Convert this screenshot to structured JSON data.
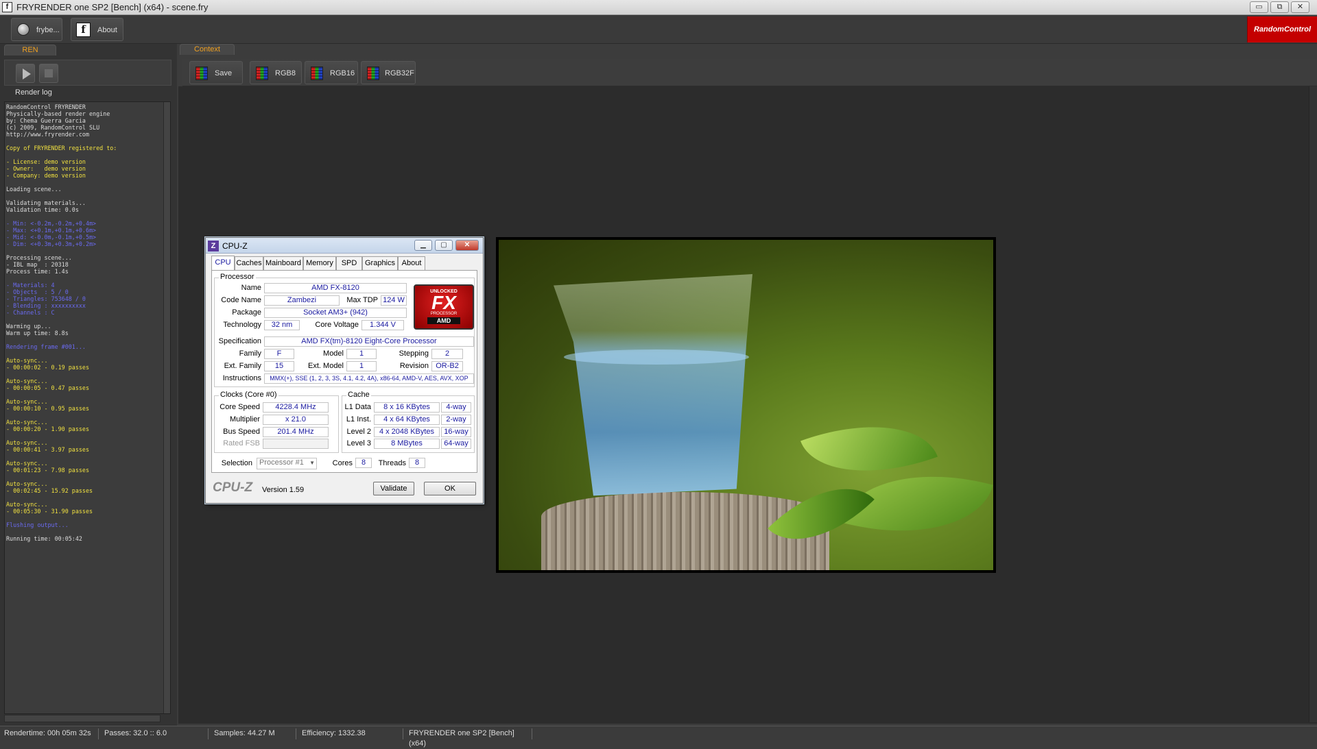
{
  "window": {
    "title": "FRYRENDER one SP2 [Bench] (x64) - scene.fry",
    "app_icon": "f",
    "controls": [
      "▭",
      "⧉",
      "✕"
    ]
  },
  "toolbar": {
    "user_label": "frybe...",
    "about_label": "About",
    "brand": "RandomControl"
  },
  "left": {
    "tab": "REN",
    "log_label": "Render log",
    "log_lines": [
      {
        "t": "RandomControl FRYRENDER",
        "c": "#dddddd"
      },
      {
        "t": "Physically-based render engine",
        "c": "#dddddd"
      },
      {
        "t": "by: Chema Guerra Garcia",
        "c": "#dddddd"
      },
      {
        "t": "(c) 2009, RandomControl SLU",
        "c": "#dddddd"
      },
      {
        "t": "http://www.fryrender.com",
        "c": "#dddddd"
      },
      {
        "t": "",
        "c": "#dddddd"
      },
      {
        "t": "Copy of FRYRENDER registered to:",
        "c": "#f0e040"
      },
      {
        "t": "",
        "c": "#dddddd"
      },
      {
        "t": "- License: demo version",
        "c": "#f0e040"
      },
      {
        "t": "- Owner:   demo version",
        "c": "#f0e040"
      },
      {
        "t": "- Company: demo version",
        "c": "#f0e040"
      },
      {
        "t": "",
        "c": "#dddddd"
      },
      {
        "t": "Loading scene...",
        "c": "#dddddd"
      },
      {
        "t": "",
        "c": "#dddddd"
      },
      {
        "t": "Validating materials...",
        "c": "#dddddd"
      },
      {
        "t": "Validation time: 0.0s",
        "c": "#dddddd"
      },
      {
        "t": "",
        "c": "#dddddd"
      },
      {
        "t": "- Min: <-0.2m,-0.2m,+0.4m>",
        "c": "#6a6af0"
      },
      {
        "t": "- Max: <+0.1m,+0.1m,+0.6m>",
        "c": "#6a6af0"
      },
      {
        "t": "- Mid: <-0.0m,-0.1m,+0.5m>",
        "c": "#6a6af0"
      },
      {
        "t": "- Dim: <+0.3m,+0.3m,+0.2m>",
        "c": "#6a6af0"
      },
      {
        "t": "",
        "c": "#dddddd"
      },
      {
        "t": "Processing scene...",
        "c": "#dddddd"
      },
      {
        "t": "- IBL map  : 20318",
        "c": "#dddddd"
      },
      {
        "t": "Process time: 1.4s",
        "c": "#dddddd"
      },
      {
        "t": "",
        "c": "#dddddd"
      },
      {
        "t": "- Materials: 4",
        "c": "#6a6af0"
      },
      {
        "t": "- Objects  : 5 / 0",
        "c": "#6a6af0"
      },
      {
        "t": "- Triangles: 753648 / 0",
        "c": "#6a6af0"
      },
      {
        "t": "- Blending : xxxxxxxxxx",
        "c": "#6a6af0"
      },
      {
        "t": "- Channels : C",
        "c": "#6a6af0"
      },
      {
        "t": "",
        "c": "#dddddd"
      },
      {
        "t": "Warming up...",
        "c": "#dddddd"
      },
      {
        "t": "Warm up time: 8.8s",
        "c": "#dddddd"
      },
      {
        "t": "",
        "c": "#dddddd"
      },
      {
        "t": "Rendering frame #001...",
        "c": "#6a6af0"
      },
      {
        "t": "",
        "c": "#dddddd"
      },
      {
        "t": "Auto-sync...",
        "c": "#f0e040"
      },
      {
        "t": "- 00:00:02 - 0.19 passes",
        "c": "#f0e040"
      },
      {
        "t": "",
        "c": "#dddddd"
      },
      {
        "t": "Auto-sync...",
        "c": "#f0e040"
      },
      {
        "t": "- 00:00:05 - 0.47 passes",
        "c": "#f0e040"
      },
      {
        "t": "",
        "c": "#dddddd"
      },
      {
        "t": "Auto-sync...",
        "c": "#f0e040"
      },
      {
        "t": "- 00:00:10 - 0.95 passes",
        "c": "#f0e040"
      },
      {
        "t": "",
        "c": "#dddddd"
      },
      {
        "t": "Auto-sync...",
        "c": "#f0e040"
      },
      {
        "t": "- 00:00:20 - 1.90 passes",
        "c": "#f0e040"
      },
      {
        "t": "",
        "c": "#dddddd"
      },
      {
        "t": "Auto-sync...",
        "c": "#f0e040"
      },
      {
        "t": "- 00:00:41 - 3.97 passes",
        "c": "#f0e040"
      },
      {
        "t": "",
        "c": "#dddddd"
      },
      {
        "t": "Auto-sync...",
        "c": "#f0e040"
      },
      {
        "t": "- 00:01:23 - 7.98 passes",
        "c": "#f0e040"
      },
      {
        "t": "",
        "c": "#dddddd"
      },
      {
        "t": "Auto-sync...",
        "c": "#f0e040"
      },
      {
        "t": "- 00:02:45 - 15.92 passes",
        "c": "#f0e040"
      },
      {
        "t": "",
        "c": "#dddddd"
      },
      {
        "t": "Auto-sync...",
        "c": "#f0e040"
      },
      {
        "t": "- 00:05:30 - 31.90 passes",
        "c": "#f0e040"
      },
      {
        "t": "",
        "c": "#dddddd"
      },
      {
        "t": "Flushing output...",
        "c": "#6a6af0"
      },
      {
        "t": "",
        "c": "#dddddd"
      },
      {
        "t": "Running time: 00:05:42",
        "c": "#dddddd"
      }
    ]
  },
  "context": {
    "tab": "Context",
    "buttons": [
      "Save",
      "RGB8",
      "RGB16",
      "RGB32F"
    ]
  },
  "status": {
    "rendertime": "Rendertime:  00h 05m 32s",
    "passes": "Passes:  32.0 :: 6.0",
    "samples": "Samples:  44.27 M",
    "efficiency": "Efficiency:  1332.38",
    "product": "FRYRENDER one SP2 [Bench] (x64)"
  },
  "cpuz": {
    "title": "CPU-Z",
    "tabs": [
      "CPU",
      "Caches",
      "Mainboard",
      "Memory",
      "SPD",
      "Graphics",
      "About"
    ],
    "processor_group": "Processor",
    "name_label": "Name",
    "name": "AMD FX-8120",
    "codename_label": "Code Name",
    "codename": "Zambezi",
    "maxtdp_label": "Max TDP",
    "maxtdp": "124 W",
    "package_label": "Package",
    "package": "Socket AM3+ (942)",
    "technology_label": "Technology",
    "technology": "32 nm",
    "corevoltage_label": "Core Voltage",
    "corevoltage": "1.344 V",
    "spec_label": "Specification",
    "spec": "AMD FX(tm)-8120 Eight-Core Processor",
    "family_label": "Family",
    "family": "F",
    "model_label": "Model",
    "model": "1",
    "stepping_label": "Stepping",
    "stepping": "2",
    "extfamily_label": "Ext. Family",
    "extfamily": "15",
    "extmodel_label": "Ext. Model",
    "extmodel": "1",
    "revision_label": "Revision",
    "revision": "OR-B2",
    "instructions_label": "Instructions",
    "instructions": "MMX(+), SSE (1, 2, 3, 3S, 4.1, 4.2, 4A), x86-64, AMD-V, AES, AVX, XOP",
    "logo_top": "UNLOCKED",
    "logo_mid": "FX",
    "logo_sub": "PROCESSOR",
    "logo_brand": "AMD",
    "clocks_group": "Clocks (Core #0)",
    "corespeed_label": "Core Speed",
    "corespeed": "4228.4 MHz",
    "multiplier_label": "Multiplier",
    "multiplier": "x 21.0",
    "busspeed_label": "Bus Speed",
    "busspeed": "201.4 MHz",
    "ratedfsb_label": "Rated FSB",
    "ratedfsb": "",
    "cache_group": "Cache",
    "l1data_label": "L1 Data",
    "l1data": "8 x 16 KBytes",
    "l1data_way": "4-way",
    "l1inst_label": "L1 Inst.",
    "l1inst": "4 x 64 KBytes",
    "l1inst_way": "2-way",
    "l2_label": "Level 2",
    "l2": "4 x 2048 KBytes",
    "l2_way": "16-way",
    "l3_label": "Level 3",
    "l3": "8 MBytes",
    "l3_way": "64-way",
    "selection_label": "Selection",
    "selection": "Processor #1",
    "cores_label": "Cores",
    "cores": "8",
    "threads_label": "Threads",
    "threads": "8",
    "brand": "CPU-Z",
    "version": "Version 1.59",
    "validate": "Validate",
    "ok": "OK"
  }
}
